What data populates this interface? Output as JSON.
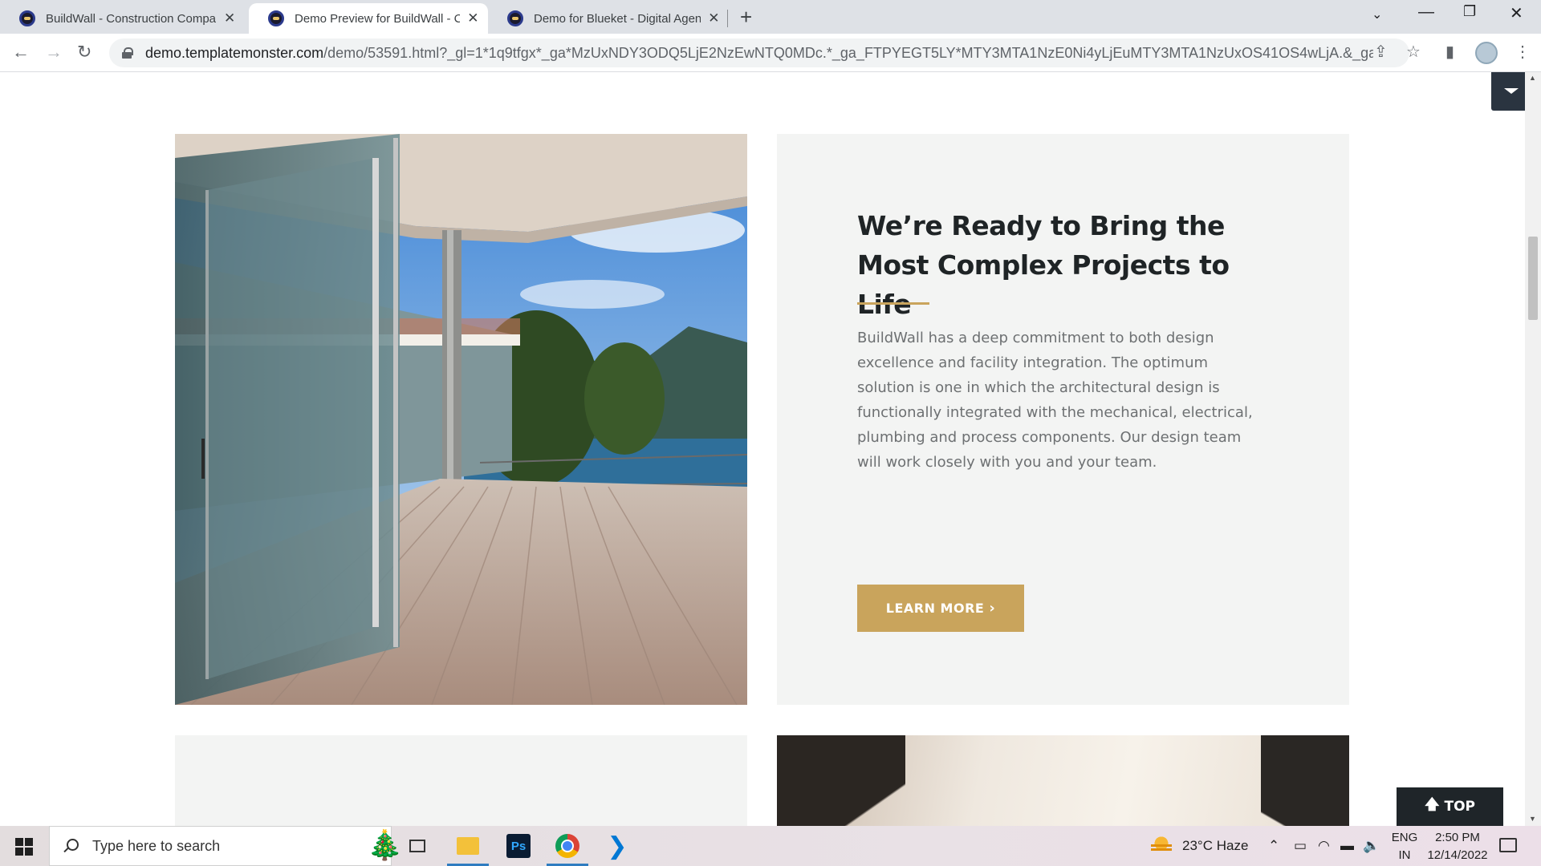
{
  "browser": {
    "tabs": [
      {
        "title": "BuildWall - Construction Compan",
        "close": "✕"
      },
      {
        "title": "Demo Preview for BuildWall - Co",
        "close": "✕"
      },
      {
        "title": "Demo for Blueket - Digital Agenc",
        "close": "✕"
      }
    ],
    "active_tab": 1,
    "new_tab": "+",
    "window_controls": {
      "minimize": "—",
      "restore": "❐",
      "close": "✕"
    },
    "url_host": "demo.templatemonster.com",
    "url_path": "/demo/53591.html?_gl=1*1q9tfgx*_ga*MzUxNDY3ODQ5LjE2NzEwNTQ0MDc.*_ga_FTPYEGT5LY*MTY3MTA1NzE0Ni4yLjEuMTY3MTA1NzUxOS41OS4wLjA.&_ga=2.10631..."
  },
  "section": {
    "heading": "We’re Ready to Bring the Most Complex Projects to Life",
    "body": "BuildWall has a deep commitment to both design excellence and facility integration. The optimum solution is one in which the architectural design is functionally integrated with the mechanical, electrical, plumbing and process components. Our design team will work closely with you and your team.",
    "button_label": "LEARN MORE",
    "accent_color": "#c9a45c"
  },
  "top_button": "TOP",
  "taskbar": {
    "search_placeholder": "Type here to search",
    "ps_label": "Ps",
    "weather": "23°C  Haze",
    "lang_line1": "ENG",
    "lang_line2": "IN",
    "time": "2:50 PM",
    "date": "12/14/2022"
  }
}
